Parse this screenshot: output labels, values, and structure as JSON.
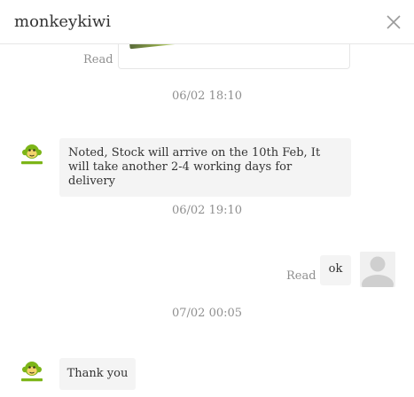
{
  "header": {
    "title": "monkeykiwi",
    "close_icon": "close-icon"
  },
  "messages": [
    {
      "type": "image",
      "side": "right",
      "status": "Read"
    },
    {
      "type": "timestamp",
      "text": "06/02 18:10"
    },
    {
      "type": "text",
      "side": "left",
      "avatar": "monkeykiwi-logo-icon",
      "text": "Noted, Stock will arrive on the 10th Feb, It will take another 2-4 working days for delivery"
    },
    {
      "type": "timestamp",
      "text": "06/02 19:10"
    },
    {
      "type": "text",
      "side": "right",
      "avatar": "user-avatar-icon",
      "status": "Read",
      "text": "ok"
    },
    {
      "type": "timestamp",
      "text": "07/02 00:05"
    },
    {
      "type": "text",
      "side": "left",
      "avatar": "monkeykiwi-logo-icon",
      "text": "Thank you"
    }
  ],
  "colors": {
    "brand_green": "#7cb518",
    "muted_text": "#8f8f8f",
    "bubble_bg": "#f4f4f4",
    "divider": "#e6e6e6"
  }
}
